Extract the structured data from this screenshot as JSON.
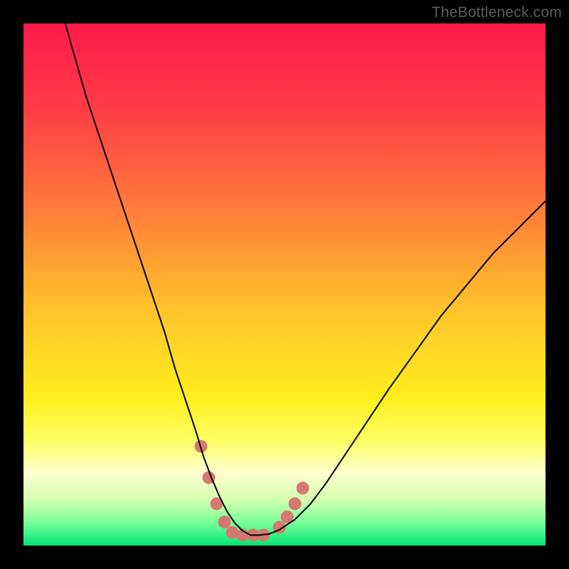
{
  "watermark": "TheBottleneck.com",
  "chart_data": {
    "type": "line",
    "title": "",
    "xlabel": "",
    "ylabel": "",
    "xlim": [
      0,
      100
    ],
    "ylim": [
      0,
      100
    ],
    "grid": false,
    "legend": false,
    "gradient_stops": [
      {
        "offset": 0.0,
        "color": "#ff1a4b"
      },
      {
        "offset": 0.16,
        "color": "#ff3b46"
      },
      {
        "offset": 0.35,
        "color": "#ff7a3a"
      },
      {
        "offset": 0.55,
        "color": "#ffc42a"
      },
      {
        "offset": 0.72,
        "color": "#ffef1f"
      },
      {
        "offset": 0.8,
        "color": "#ffff66"
      },
      {
        "offset": 0.86,
        "color": "#ffffd0"
      },
      {
        "offset": 0.91,
        "color": "#d6ffb0"
      },
      {
        "offset": 0.955,
        "color": "#7dff9a"
      },
      {
        "offset": 1.0,
        "color": "#00e676"
      }
    ],
    "series": [
      {
        "name": "bottleneck-curve",
        "color": "#000000",
        "stroke_width": 2,
        "x": [
          8.0,
          10,
          12,
          15,
          18,
          21,
          24,
          27,
          29,
          31,
          33,
          34.5,
          36,
          37.5,
          39,
          40.5,
          42,
          43.5,
          45,
          47,
          49,
          52,
          55,
          58,
          62,
          66,
          70,
          75,
          80,
          85,
          90,
          95,
          100
        ],
        "y": [
          100,
          93,
          86,
          77,
          68,
          59,
          50,
          41,
          34,
          28,
          22,
          17,
          13,
          9.5,
          6.5,
          4.3,
          2.8,
          2.0,
          2.0,
          2.2,
          3.0,
          5.0,
          8.0,
          12,
          18,
          24,
          30,
          37,
          44,
          50,
          56,
          61,
          66
        ]
      }
    ],
    "markers": {
      "name": "highlight-dots",
      "color": "#d5786f",
      "radius": 9,
      "points": [
        {
          "x": 34.0,
          "y": 19
        },
        {
          "x": 35.5,
          "y": 13
        },
        {
          "x": 37.0,
          "y": 8
        },
        {
          "x": 38.5,
          "y": 4.5
        },
        {
          "x": 40.0,
          "y": 2.5
        },
        {
          "x": 42.0,
          "y": 2.0
        },
        {
          "x": 44.0,
          "y": 2.0
        },
        {
          "x": 46.0,
          "y": 2.0
        },
        {
          "x": 49.0,
          "y": 3.5
        },
        {
          "x": 50.5,
          "y": 5.5
        },
        {
          "x": 52.0,
          "y": 8.0
        },
        {
          "x": 53.5,
          "y": 11
        }
      ]
    }
  }
}
